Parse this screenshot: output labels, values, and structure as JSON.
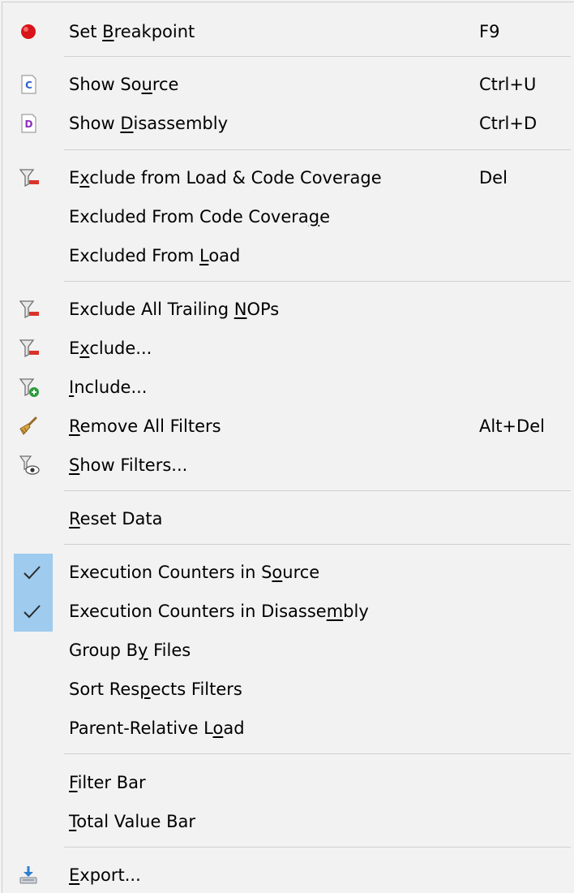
{
  "menu": {
    "items": [
      {
        "id": "set-breakpoint",
        "pre": "Set ",
        "ul": "B",
        "post": "reakpoint",
        "shortcut": "F9",
        "icon": "breakpoint-icon"
      },
      {
        "id": "show-source",
        "pre": "Show So",
        "ul": "u",
        "post": "rce",
        "shortcut": "Ctrl+U",
        "icon": "source-file-icon"
      },
      {
        "id": "show-disassembly",
        "pre": "Show ",
        "ul": "D",
        "post": "isassembly",
        "shortcut": "Ctrl+D",
        "icon": "disassembly-file-icon"
      },
      {
        "id": "exclude-load-coverage",
        "pre": "E",
        "ul": "x",
        "post": "clude from Load & Code Coverage",
        "shortcut": "Del",
        "icon": "filter-exclude-icon"
      },
      {
        "id": "excluded-code-coverage",
        "pre": "Excluded From Code Covera",
        "ul": "g",
        "post": "e",
        "shortcut": "",
        "icon": ""
      },
      {
        "id": "excluded-load",
        "pre": "Excluded From ",
        "ul": "L",
        "post": "oad",
        "shortcut": "",
        "icon": ""
      },
      {
        "id": "exclude-trailing-nops",
        "pre": "Exclude All Trailing ",
        "ul": "N",
        "post": "OPs",
        "shortcut": "",
        "icon": "filter-exclude-icon"
      },
      {
        "id": "exclude",
        "pre": "E",
        "ul": "x",
        "post": "clude...",
        "shortcut": "",
        "icon": "filter-exclude-icon"
      },
      {
        "id": "include",
        "pre": "",
        "ul": "I",
        "post": "nclude...",
        "shortcut": "",
        "icon": "filter-include-icon"
      },
      {
        "id": "remove-all-filters",
        "pre": "",
        "ul": "R",
        "post": "emove All Filters",
        "shortcut": "Alt+Del",
        "icon": "broom-icon"
      },
      {
        "id": "show-filters",
        "pre": "",
        "ul": "S",
        "post": "how Filters...",
        "shortcut": "",
        "icon": "filter-view-icon"
      },
      {
        "id": "reset-data",
        "pre": "",
        "ul": "R",
        "post": "eset Data",
        "shortcut": "",
        "icon": ""
      },
      {
        "id": "exec-counters-source",
        "pre": "Execution Counters in S",
        "ul": "o",
        "post": "urce",
        "shortcut": "",
        "icon": "",
        "checked": true
      },
      {
        "id": "exec-counters-disassembly",
        "pre": "Execution Counters in Disasse",
        "ul": "m",
        "post": "bly",
        "shortcut": "",
        "icon": "",
        "checked": true
      },
      {
        "id": "group-by-files",
        "pre": "Group B",
        "ul": "y",
        "post": " Files",
        "shortcut": "",
        "icon": ""
      },
      {
        "id": "sort-respects-filters",
        "pre": "Sort Res",
        "ul": "p",
        "post": "ects Filters",
        "shortcut": "",
        "icon": ""
      },
      {
        "id": "parent-relative-load",
        "pre": "Parent-Relative L",
        "ul": "o",
        "post": "ad",
        "shortcut": "",
        "icon": ""
      },
      {
        "id": "filter-bar",
        "pre": "",
        "ul": "F",
        "post": "ilter Bar",
        "shortcut": "",
        "icon": ""
      },
      {
        "id": "total-value-bar",
        "pre": "",
        "ul": "T",
        "post": "otal Value Bar",
        "shortcut": "",
        "icon": ""
      },
      {
        "id": "export",
        "pre": "",
        "ul": "E",
        "post": "xport...",
        "shortcut": "",
        "icon": "export-icon"
      }
    ]
  },
  "colors": {
    "menu_bg": "#f2f2f2",
    "separator": "#d0d0d0",
    "check_highlight": "#9ecbee",
    "breakpoint_red": "#d8141a",
    "filter_red": "#d9332c",
    "filter_green": "#2e9a3c"
  }
}
